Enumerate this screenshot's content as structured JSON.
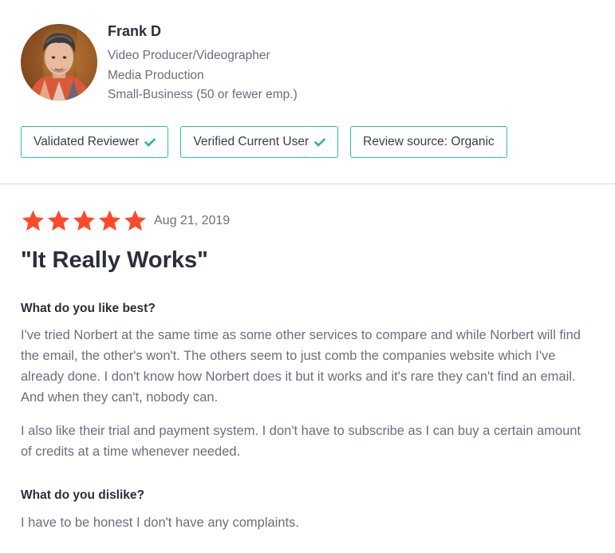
{
  "reviewer": {
    "name": "Frank D",
    "title": "Video Producer/Videographer",
    "industry": "Media Production",
    "company_size": "Small-Business (50 or fewer emp.)"
  },
  "badges": [
    {
      "label": "Validated Reviewer",
      "icon": "check-icon"
    },
    {
      "label": "Verified Current User",
      "icon": "check-icon"
    },
    {
      "label": "Review source: Organic"
    }
  ],
  "review": {
    "rating": 5,
    "max_rating": 5,
    "date": "Aug 21, 2019",
    "title": "\"It Really Works\"",
    "like_best_question": "What do you like best?",
    "like_best_paragraphs": [
      "I've tried Norbert at the same time as some other services to compare and while Norbert will find the email, the other's won't. The others seem to just comb the companies website which I've already done. I don't know how Norbert does it but it works and it's rare they can't find an email. And when they can't, nobody can.",
      "I also like their trial and payment system. I don't have to subscribe as I can buy a certain amount of credits at a time whenever needed."
    ],
    "dislike_question": "What do you dislike?",
    "dislike_answer": "I have to be honest I don't have any complaints."
  },
  "colors": {
    "star": "#ff492c",
    "badge_border": "#2fbfa3",
    "check": "#27b99a",
    "text": "#2b2e3a",
    "muted_text": "#6b6f7c"
  }
}
